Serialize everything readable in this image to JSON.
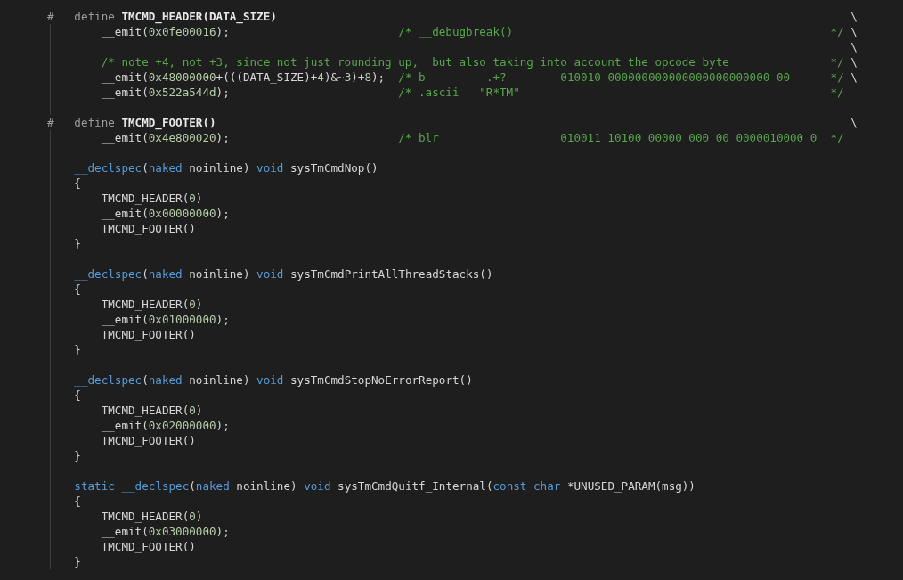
{
  "editor": {
    "lines": [
      {
        "kind": "directive",
        "tokens": [
          {
            "kind": "preproc",
            "text": "#   define "
          },
          {
            "kind": "macro",
            "text": "TMCMD_HEADER(DATA_SIZE)"
          },
          {
            "kind": "plain",
            "text": "                                                                                     \\"
          }
        ]
      },
      {
        "kind": "code",
        "tokens": [
          {
            "kind": "plain",
            "text": "        __emit("
          },
          {
            "kind": "number",
            "text": "0x0fe00016"
          },
          {
            "kind": "plain",
            "text": ");                         "
          },
          {
            "kind": "comment",
            "text": "/* __debugbreak()                                               */"
          },
          {
            "kind": "plain",
            "text": " \\"
          }
        ]
      },
      {
        "kind": "code",
        "tokens": [
          {
            "kind": "plain",
            "text": "                                                                                                                       \\"
          }
        ]
      },
      {
        "kind": "code",
        "tokens": [
          {
            "kind": "comment",
            "text": "        /* note +4, not +3, since not just rounding up,  but also taking into account the opcode byte               */"
          },
          {
            "kind": "plain",
            "text": " \\"
          }
        ]
      },
      {
        "kind": "code",
        "tokens": [
          {
            "kind": "plain",
            "text": "        __emit("
          },
          {
            "kind": "number",
            "text": "0x48000000"
          },
          {
            "kind": "plain",
            "text": "+(((DATA_SIZE)+"
          },
          {
            "kind": "number",
            "text": "4"
          },
          {
            "kind": "plain",
            "text": ")&~"
          },
          {
            "kind": "number",
            "text": "3"
          },
          {
            "kind": "plain",
            "text": ")+"
          },
          {
            "kind": "number",
            "text": "8"
          },
          {
            "kind": "plain",
            "text": ");  "
          },
          {
            "kind": "comment",
            "text": "/* b         .+?        010010 000000000000000000000000 00      */"
          },
          {
            "kind": "plain",
            "text": " \\"
          }
        ]
      },
      {
        "kind": "code",
        "tokens": [
          {
            "kind": "plain",
            "text": "        __emit("
          },
          {
            "kind": "number",
            "text": "0x522a544d"
          },
          {
            "kind": "plain",
            "text": ");                         "
          },
          {
            "kind": "comment",
            "text": "/* .ascii   \"R*TM\"                                              */"
          }
        ]
      },
      {
        "kind": "blank"
      },
      {
        "kind": "directive",
        "tokens": [
          {
            "kind": "preproc",
            "text": "#   define "
          },
          {
            "kind": "macro",
            "text": "TMCMD_FOOTER()"
          },
          {
            "kind": "plain",
            "text": "                                                                                              \\"
          }
        ]
      },
      {
        "kind": "code",
        "tokens": [
          {
            "kind": "plain",
            "text": "        __emit("
          },
          {
            "kind": "number",
            "text": "0x4e800020"
          },
          {
            "kind": "plain",
            "text": ");                         "
          },
          {
            "kind": "comment",
            "text": "/* blr                  010011 10100 00000 000 00 0000010000 0  */"
          }
        ]
      },
      {
        "kind": "blank"
      },
      {
        "kind": "code",
        "tokens": [
          {
            "kind": "keyword",
            "text": "    __declspec"
          },
          {
            "kind": "plain",
            "text": "("
          },
          {
            "kind": "keyword",
            "text": "naked"
          },
          {
            "kind": "plain",
            "text": " noinline) "
          },
          {
            "kind": "keyword",
            "text": "void"
          },
          {
            "kind": "plain",
            "text": " sysTmCmdNop()"
          }
        ]
      },
      {
        "kind": "code",
        "tokens": [
          {
            "kind": "plain",
            "text": "    {"
          }
        ]
      },
      {
        "kind": "body",
        "tokens": [
          {
            "kind": "plain",
            "text": "        TMCMD_HEADER("
          },
          {
            "kind": "number",
            "text": "0"
          },
          {
            "kind": "plain",
            "text": ")"
          }
        ]
      },
      {
        "kind": "body",
        "tokens": [
          {
            "kind": "plain",
            "text": "        __emit("
          },
          {
            "kind": "number",
            "text": "0x00000000"
          },
          {
            "kind": "plain",
            "text": ");"
          }
        ]
      },
      {
        "kind": "body",
        "tokens": [
          {
            "kind": "plain",
            "text": "        TMCMD_FOOTER()"
          }
        ]
      },
      {
        "kind": "code",
        "tokens": [
          {
            "kind": "plain",
            "text": "    }"
          }
        ]
      },
      {
        "kind": "blank"
      },
      {
        "kind": "code",
        "tokens": [
          {
            "kind": "keyword",
            "text": "    __declspec"
          },
          {
            "kind": "plain",
            "text": "("
          },
          {
            "kind": "keyword",
            "text": "naked"
          },
          {
            "kind": "plain",
            "text": " noinline) "
          },
          {
            "kind": "keyword",
            "text": "void"
          },
          {
            "kind": "plain",
            "text": " sysTmCmdPrintAllThreadStacks()"
          }
        ]
      },
      {
        "kind": "code",
        "tokens": [
          {
            "kind": "plain",
            "text": "    {"
          }
        ]
      },
      {
        "kind": "body",
        "tokens": [
          {
            "kind": "plain",
            "text": "        TMCMD_HEADER("
          },
          {
            "kind": "number",
            "text": "0"
          },
          {
            "kind": "plain",
            "text": ")"
          }
        ]
      },
      {
        "kind": "body",
        "tokens": [
          {
            "kind": "plain",
            "text": "        __emit("
          },
          {
            "kind": "number",
            "text": "0x01000000"
          },
          {
            "kind": "plain",
            "text": ");"
          }
        ]
      },
      {
        "kind": "body",
        "tokens": [
          {
            "kind": "plain",
            "text": "        TMCMD_FOOTER()"
          }
        ]
      },
      {
        "kind": "code",
        "tokens": [
          {
            "kind": "plain",
            "text": "    }"
          }
        ]
      },
      {
        "kind": "blank"
      },
      {
        "kind": "code",
        "tokens": [
          {
            "kind": "keyword",
            "text": "    __declspec"
          },
          {
            "kind": "plain",
            "text": "("
          },
          {
            "kind": "keyword",
            "text": "naked"
          },
          {
            "kind": "plain",
            "text": " noinline) "
          },
          {
            "kind": "keyword",
            "text": "void"
          },
          {
            "kind": "plain",
            "text": " sysTmCmdStopNoErrorReport()"
          }
        ]
      },
      {
        "kind": "code",
        "tokens": [
          {
            "kind": "plain",
            "text": "    {"
          }
        ]
      },
      {
        "kind": "body",
        "tokens": [
          {
            "kind": "plain",
            "text": "        TMCMD_HEADER("
          },
          {
            "kind": "number",
            "text": "0"
          },
          {
            "kind": "plain",
            "text": ")"
          }
        ]
      },
      {
        "kind": "body",
        "tokens": [
          {
            "kind": "plain",
            "text": "        __emit("
          },
          {
            "kind": "number",
            "text": "0x02000000"
          },
          {
            "kind": "plain",
            "text": ");"
          }
        ]
      },
      {
        "kind": "body",
        "tokens": [
          {
            "kind": "plain",
            "text": "        TMCMD_FOOTER()"
          }
        ]
      },
      {
        "kind": "code",
        "tokens": [
          {
            "kind": "plain",
            "text": "    }"
          }
        ]
      },
      {
        "kind": "blank"
      },
      {
        "kind": "code",
        "tokens": [
          {
            "kind": "keyword",
            "text": "    static __declspec"
          },
          {
            "kind": "plain",
            "text": "("
          },
          {
            "kind": "keyword",
            "text": "naked"
          },
          {
            "kind": "plain",
            "text": " noinline) "
          },
          {
            "kind": "keyword",
            "text": "void"
          },
          {
            "kind": "plain",
            "text": " sysTmCmdQuitf_Internal("
          },
          {
            "kind": "keyword",
            "text": "const char"
          },
          {
            "kind": "plain",
            "text": " *UNUSED_PARAM(msg))"
          }
        ]
      },
      {
        "kind": "code",
        "tokens": [
          {
            "kind": "plain",
            "text": "    {"
          }
        ]
      },
      {
        "kind": "body",
        "tokens": [
          {
            "kind": "plain",
            "text": "        TMCMD_HEADER("
          },
          {
            "kind": "number",
            "text": "0"
          },
          {
            "kind": "plain",
            "text": ")"
          }
        ]
      },
      {
        "kind": "body",
        "tokens": [
          {
            "kind": "plain",
            "text": "        __emit("
          },
          {
            "kind": "number",
            "text": "0x03000000"
          },
          {
            "kind": "plain",
            "text": ");"
          }
        ]
      },
      {
        "kind": "body",
        "tokens": [
          {
            "kind": "plain",
            "text": "        TMCMD_FOOTER()"
          }
        ]
      },
      {
        "kind": "code",
        "tokens": [
          {
            "kind": "plain",
            "text": "    }"
          }
        ]
      }
    ]
  }
}
